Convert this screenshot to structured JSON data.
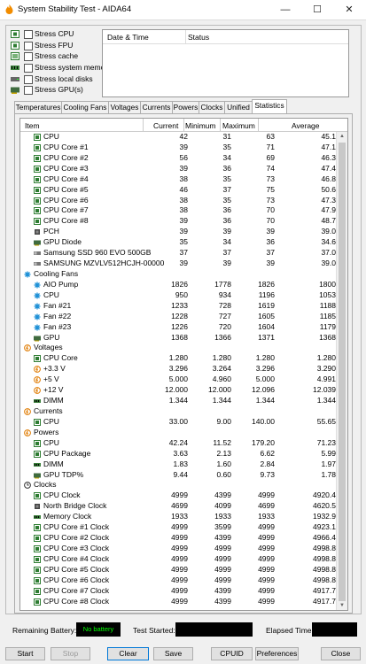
{
  "window": {
    "title": "System Stability Test - AIDA64",
    "min_glyph": "—",
    "max_glyph": "☐",
    "close_glyph": "✕"
  },
  "stress_options": [
    {
      "label": "Stress CPU",
      "icon": "cpu-icon",
      "checked": false
    },
    {
      "label": "Stress FPU",
      "icon": "fpu-icon",
      "checked": false
    },
    {
      "label": "Stress cache",
      "icon": "cache-icon",
      "checked": false
    },
    {
      "label": "Stress system memory",
      "icon": "memory-icon",
      "checked": false
    },
    {
      "label": "Stress local disks",
      "icon": "disk-icon",
      "checked": false
    },
    {
      "label": "Stress GPU(s)",
      "icon": "gpu-icon",
      "checked": false
    }
  ],
  "log": {
    "col_datetime": "Date & Time",
    "col_status": "Status"
  },
  "tabs": [
    "Temperatures",
    "Cooling Fans",
    "Voltages",
    "Currents",
    "Powers",
    "Clocks",
    "Unified",
    "Statistics"
  ],
  "active_tab": "Statistics",
  "table": {
    "headers": {
      "item": "Item",
      "current": "Current",
      "minimum": "Minimum",
      "maximum": "Maximum",
      "average": "Average"
    },
    "rows": [
      {
        "type": "item",
        "icon": "cpu-icon",
        "name": "CPU",
        "cur": "42",
        "min": "31",
        "max": "63",
        "avg": "45.1"
      },
      {
        "type": "item",
        "icon": "cpu-icon",
        "name": "CPU Core #1",
        "cur": "39",
        "min": "35",
        "max": "71",
        "avg": "47.1"
      },
      {
        "type": "item",
        "icon": "cpu-icon",
        "name": "CPU Core #2",
        "cur": "56",
        "min": "34",
        "max": "69",
        "avg": "46.3"
      },
      {
        "type": "item",
        "icon": "cpu-icon",
        "name": "CPU Core #3",
        "cur": "39",
        "min": "36",
        "max": "74",
        "avg": "47.4"
      },
      {
        "type": "item",
        "icon": "cpu-icon",
        "name": "CPU Core #4",
        "cur": "38",
        "min": "35",
        "max": "73",
        "avg": "46.8"
      },
      {
        "type": "item",
        "icon": "cpu-icon",
        "name": "CPU Core #5",
        "cur": "46",
        "min": "37",
        "max": "75",
        "avg": "50.6"
      },
      {
        "type": "item",
        "icon": "cpu-icon",
        "name": "CPU Core #6",
        "cur": "38",
        "min": "35",
        "max": "73",
        "avg": "47.3"
      },
      {
        "type": "item",
        "icon": "cpu-icon",
        "name": "CPU Core #7",
        "cur": "38",
        "min": "36",
        "max": "70",
        "avg": "47.9"
      },
      {
        "type": "item",
        "icon": "cpu-icon",
        "name": "CPU Core #8",
        "cur": "39",
        "min": "36",
        "max": "70",
        "avg": "48.7"
      },
      {
        "type": "item",
        "icon": "chip-icon",
        "name": "PCH",
        "cur": "39",
        "min": "39",
        "max": "39",
        "avg": "39.0"
      },
      {
        "type": "item",
        "icon": "gpu-icon",
        "name": "GPU Diode",
        "cur": "35",
        "min": "34",
        "max": "36",
        "avg": "34.6"
      },
      {
        "type": "item",
        "icon": "ssd-icon",
        "name": "Samsung SSD 960 EVO 500GB",
        "cur": "37",
        "min": "37",
        "max": "37",
        "avg": "37.0"
      },
      {
        "type": "item",
        "icon": "ssd-icon",
        "name": "SAMSUNG MZVLV512HCJH-00000",
        "cur": "39",
        "min": "39",
        "max": "39",
        "avg": "39.0"
      },
      {
        "type": "group",
        "icon": "fan-icon",
        "name": "Cooling Fans"
      },
      {
        "type": "item",
        "icon": "fan-icon",
        "name": "AIO Pump",
        "cur": "1826",
        "min": "1778",
        "max": "1826",
        "avg": "1800"
      },
      {
        "type": "item",
        "icon": "fan-icon",
        "name": "CPU",
        "cur": "950",
        "min": "934",
        "max": "1196",
        "avg": "1053"
      },
      {
        "type": "item",
        "icon": "fan-icon",
        "name": "Fan #21",
        "cur": "1233",
        "min": "728",
        "max": "1619",
        "avg": "1188"
      },
      {
        "type": "item",
        "icon": "fan-icon",
        "name": "Fan #22",
        "cur": "1228",
        "min": "727",
        "max": "1605",
        "avg": "1185"
      },
      {
        "type": "item",
        "icon": "fan-icon",
        "name": "Fan #23",
        "cur": "1226",
        "min": "720",
        "max": "1604",
        "avg": "1179"
      },
      {
        "type": "item",
        "icon": "gpu-icon",
        "name": "GPU",
        "cur": "1368",
        "min": "1366",
        "max": "1371",
        "avg": "1368"
      },
      {
        "type": "group",
        "icon": "voltage-icon",
        "name": "Voltages"
      },
      {
        "type": "item",
        "icon": "cpu-icon",
        "name": "CPU Core",
        "cur": "1.280",
        "min": "1.280",
        "max": "1.280",
        "avg": "1.280"
      },
      {
        "type": "item",
        "icon": "voltage-icon",
        "name": "+3.3 V",
        "cur": "3.296",
        "min": "3.264",
        "max": "3.296",
        "avg": "3.290"
      },
      {
        "type": "item",
        "icon": "voltage-icon",
        "name": "+5 V",
        "cur": "5.000",
        "min": "4.960",
        "max": "5.000",
        "avg": "4.991"
      },
      {
        "type": "item",
        "icon": "voltage-icon",
        "name": "+12 V",
        "cur": "12.000",
        "min": "12.000",
        "max": "12.096",
        "avg": "12.039"
      },
      {
        "type": "item",
        "icon": "memory-icon",
        "name": "DIMM",
        "cur": "1.344",
        "min": "1.344",
        "max": "1.344",
        "avg": "1.344"
      },
      {
        "type": "group",
        "icon": "voltage-icon",
        "name": "Currents"
      },
      {
        "type": "item",
        "icon": "cpu-icon",
        "name": "CPU",
        "cur": "33.00",
        "min": "9.00",
        "max": "140.00",
        "avg": "55.65"
      },
      {
        "type": "group",
        "icon": "voltage-icon",
        "name": "Powers"
      },
      {
        "type": "item",
        "icon": "cpu-icon",
        "name": "CPU",
        "cur": "42.24",
        "min": "11.52",
        "max": "179.20",
        "avg": "71.23"
      },
      {
        "type": "item",
        "icon": "cpu-icon",
        "name": "CPU Package",
        "cur": "3.63",
        "min": "2.13",
        "max": "6.62",
        "avg": "5.99"
      },
      {
        "type": "item",
        "icon": "memory-icon",
        "name": "DIMM",
        "cur": "1.83",
        "min": "1.60",
        "max": "2.84",
        "avg": "1.97"
      },
      {
        "type": "item",
        "icon": "gpu-icon",
        "name": "GPU TDP%",
        "cur": "9.44",
        "min": "0.60",
        "max": "9.73",
        "avg": "1.78"
      },
      {
        "type": "group",
        "icon": "clock-icon",
        "name": "Clocks"
      },
      {
        "type": "item",
        "icon": "cpu-icon",
        "name": "CPU Clock",
        "cur": "4999",
        "min": "4399",
        "max": "4999",
        "avg": "4920.4"
      },
      {
        "type": "item",
        "icon": "chip-icon",
        "name": "North Bridge Clock",
        "cur": "4699",
        "min": "4099",
        "max": "4699",
        "avg": "4620.5"
      },
      {
        "type": "item",
        "icon": "memory-icon",
        "name": "Memory Clock",
        "cur": "1933",
        "min": "1933",
        "max": "1933",
        "avg": "1932.9"
      },
      {
        "type": "item",
        "icon": "cpu-icon",
        "name": "CPU Core #1 Clock",
        "cur": "4999",
        "min": "3599",
        "max": "4999",
        "avg": "4923.1"
      },
      {
        "type": "item",
        "icon": "cpu-icon",
        "name": "CPU Core #2 Clock",
        "cur": "4999",
        "min": "4399",
        "max": "4999",
        "avg": "4966.4"
      },
      {
        "type": "item",
        "icon": "cpu-icon",
        "name": "CPU Core #3 Clock",
        "cur": "4999",
        "min": "4999",
        "max": "4999",
        "avg": "4998.8"
      },
      {
        "type": "item",
        "icon": "cpu-icon",
        "name": "CPU Core #4 Clock",
        "cur": "4999",
        "min": "4999",
        "max": "4999",
        "avg": "4998.8"
      },
      {
        "type": "item",
        "icon": "cpu-icon",
        "name": "CPU Core #5 Clock",
        "cur": "4999",
        "min": "4999",
        "max": "4999",
        "avg": "4998.8"
      },
      {
        "type": "item",
        "icon": "cpu-icon",
        "name": "CPU Core #6 Clock",
        "cur": "4999",
        "min": "4999",
        "max": "4999",
        "avg": "4998.8"
      },
      {
        "type": "item",
        "icon": "cpu-icon",
        "name": "CPU Core #7 Clock",
        "cur": "4999",
        "min": "4399",
        "max": "4999",
        "avg": "4917.7"
      },
      {
        "type": "item",
        "icon": "cpu-icon",
        "name": "CPU Core #8 Clock",
        "cur": "4999",
        "min": "4399",
        "max": "4999",
        "avg": "4917.7"
      }
    ]
  },
  "status_bar": {
    "battery_label": "Remaining Battery:",
    "battery_value": "No battery",
    "started_label": "Test Started:",
    "elapsed_label": "Elapsed Time:"
  },
  "buttons": {
    "start": "Start",
    "stop": "Stop",
    "clear": "Clear",
    "save": "Save",
    "cpuid": "CPUID",
    "preferences": "Preferences",
    "close": "Close"
  },
  "colors": {
    "cpu_icon": "#2e7d32",
    "fan_icon": "#1e90d6",
    "voltage_icon": "#e07b00",
    "clock_icon": "#333333",
    "battery_text": "#00ff00"
  }
}
